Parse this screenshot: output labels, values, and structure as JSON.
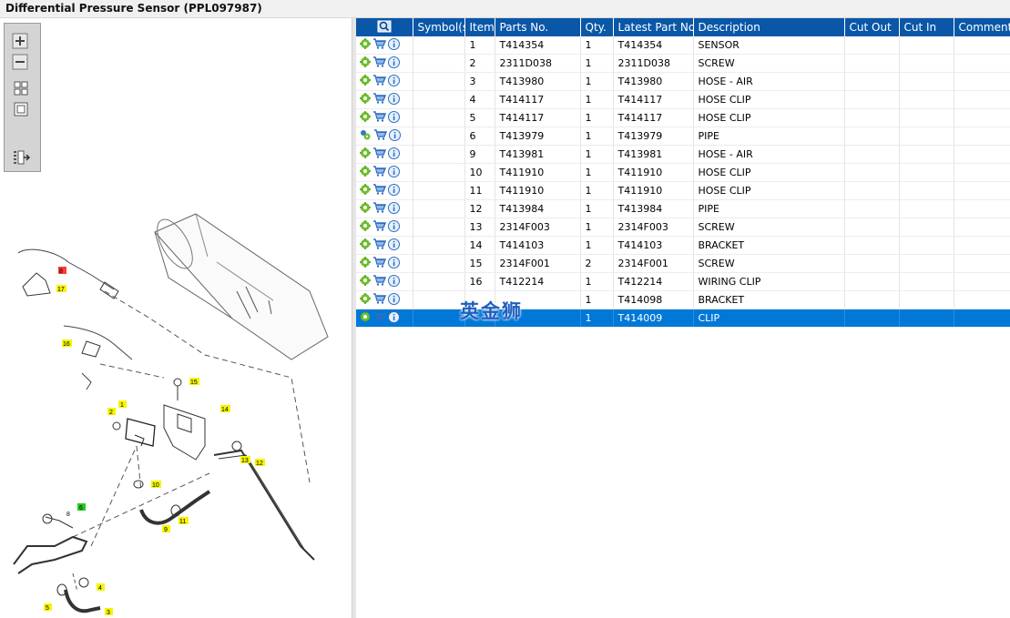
{
  "window": {
    "title": "Differential Pressure Sensor (PPL097987)"
  },
  "toolbar": {
    "zoom_in": "zoom-in-icon",
    "zoom_out": "zoom-out-icon",
    "fit": "fit-all-icon",
    "actual": "actual-size-icon",
    "list": "parts-list-icon"
  },
  "grid": {
    "columns": [
      "",
      "Symbol(s)",
      "Item",
      "Parts No.",
      "Qty.",
      "Latest Part No.",
      "Description",
      "Cut Out",
      "Cut In",
      "Comment"
    ],
    "rows": [
      {
        "item": "1",
        "part": "T414354",
        "qty": "1",
        "latest": "T414354",
        "desc": "SENSOR"
      },
      {
        "item": "2",
        "part": "2311D038",
        "qty": "1",
        "latest": "2311D038",
        "desc": "SCREW"
      },
      {
        "item": "3",
        "part": "T413980",
        "qty": "1",
        "latest": "T413980",
        "desc": "HOSE - AIR"
      },
      {
        "item": "4",
        "part": "T414117",
        "qty": "1",
        "latest": "T414117",
        "desc": "HOSE CLIP"
      },
      {
        "item": "5",
        "part": "T414117",
        "qty": "1",
        "latest": "T414117",
        "desc": "HOSE CLIP"
      },
      {
        "item": "6",
        "part": "T413979",
        "qty": "1",
        "latest": "T413979",
        "desc": "PIPE"
      },
      {
        "item": "9",
        "part": "T413981",
        "qty": "1",
        "latest": "T413981",
        "desc": "HOSE - AIR"
      },
      {
        "item": "10",
        "part": "T411910",
        "qty": "1",
        "latest": "T411910",
        "desc": "HOSE CLIP"
      },
      {
        "item": "11",
        "part": "T411910",
        "qty": "1",
        "latest": "T411910",
        "desc": "HOSE CLIP"
      },
      {
        "item": "12",
        "part": "T413984",
        "qty": "1",
        "latest": "T413984",
        "desc": "PIPE"
      },
      {
        "item": "13",
        "part": "2314F003",
        "qty": "1",
        "latest": "2314F003",
        "desc": "SCREW"
      },
      {
        "item": "14",
        "part": "T414103",
        "qty": "1",
        "latest": "T414103",
        "desc": "BRACKET"
      },
      {
        "item": "15",
        "part": "2314F001",
        "qty": "2",
        "latest": "2314F001",
        "desc": "SCREW"
      },
      {
        "item": "16",
        "part": "T412214",
        "qty": "1",
        "latest": "T412214",
        "desc": "WIRING CLIP"
      },
      {
        "item": "",
        "part": "",
        "qty": "1",
        "latest": "T414098",
        "desc": "BRACKET"
      },
      {
        "item": "",
        "part": "",
        "qty": "1",
        "latest": "T414009",
        "desc": "CLIP"
      }
    ],
    "selected_row": 15
  },
  "watermark": "英金狮",
  "diagram": {
    "callouts": [
      "17",
      "16",
      "15",
      "14",
      "2",
      "1",
      "13",
      "12",
      "10",
      "11",
      "9",
      "8",
      "6",
      "4",
      "5",
      "3"
    ]
  },
  "colors": {
    "header_bg": "#0a57a8",
    "selected_bg": "#0078d7",
    "callout_yellow": "#f5f500",
    "callout_green": "#22cc22",
    "callout_red": "#ff3b3b"
  }
}
